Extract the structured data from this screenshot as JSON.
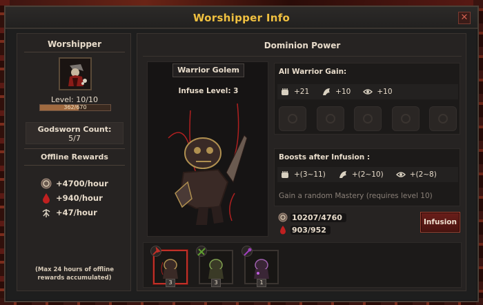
{
  "window": {
    "title": "Worshipper Info",
    "close_label": "✕"
  },
  "worshipper": {
    "header": "Worshipper",
    "level_text": "Level: 10/10",
    "xp_text": "362/670",
    "xp_progress": 0.54,
    "godsworn_label": "Godsworn Count:",
    "godsworn_value": "5/7",
    "offline_title": "Offline Rewards",
    "rewards": [
      {
        "icon": "gold-coin-icon",
        "text": "+4700/hour"
      },
      {
        "icon": "blood-drop-icon",
        "text": "+940/hour"
      },
      {
        "icon": "bone-icon",
        "text": "+47/hour"
      }
    ],
    "offline_note": "(Max 24 hours of offline rewards accumulated)"
  },
  "dominion": {
    "header": "Dominion Power",
    "golem_name": "Warrior Golem",
    "infuse_level": "Infuse Level: 3",
    "all_gain_label": "All Warrior Gain:",
    "all_gain": [
      {
        "icon": "fist-icon",
        "value": "+21"
      },
      {
        "icon": "wing-icon",
        "value": "+10"
      },
      {
        "icon": "eye-icon",
        "value": "+10"
      }
    ],
    "boosts_label": "Boosts after Infusion :",
    "boosts": [
      {
        "icon": "fist-icon",
        "value": "+(3~11)"
      },
      {
        "icon": "wing-icon",
        "value": "+(2~10)"
      },
      {
        "icon": "eye-icon",
        "value": "+(2~8)"
      }
    ],
    "mastery_text": "Gain a random Mastery (requires level 10)",
    "gold": "10207/4760",
    "blood": "903/952",
    "infusion_label": "Infusion",
    "golems": [
      {
        "name": "warrior-golem-card",
        "count": "3",
        "selected": true,
        "color": "#c03028"
      },
      {
        "name": "ranger-golem-card",
        "count": "3",
        "selected": false,
        "color": "#60a030"
      },
      {
        "name": "mage-golem-card",
        "count": "1",
        "selected": false,
        "color": "#a040c0"
      }
    ]
  }
}
